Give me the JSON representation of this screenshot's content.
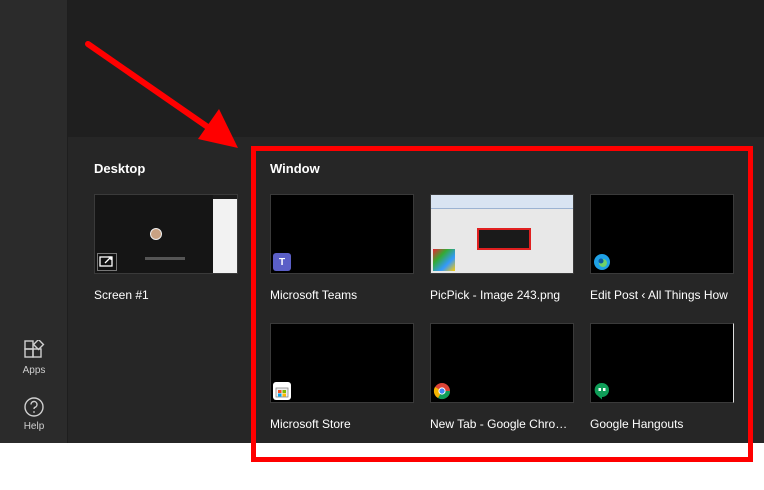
{
  "sidebar": {
    "apps_label": "Apps",
    "help_label": "Help",
    "apps_icon": "apps-icon",
    "help_icon": "help-icon"
  },
  "sections": {
    "desktop_title": "Desktop",
    "window_title": "Window"
  },
  "desktop": {
    "screen_label": "Screen #1",
    "icon": "screen-share-icon"
  },
  "windows": [
    {
      "label": "Microsoft Teams",
      "icon": "teams-icon",
      "color": "#5b5fc7"
    },
    {
      "label": "PicPick - Image 243.png",
      "icon": "picpick-icon",
      "color": "#e02020"
    },
    {
      "label": "Edit Post ‹ All Things How",
      "icon": "edge-icon",
      "color": "#1fa1e6"
    },
    {
      "label": "Microsoft Store",
      "icon": "store-icon",
      "color": "#ffffff"
    },
    {
      "label": "New Tab - Google Chrome",
      "icon": "chrome-icon",
      "color": "#db4437"
    },
    {
      "label": "Google Hangouts",
      "icon": "hangouts-icon",
      "color": "#0f9d58"
    }
  ],
  "annotation": {
    "highlight_color": "#ff0000"
  }
}
